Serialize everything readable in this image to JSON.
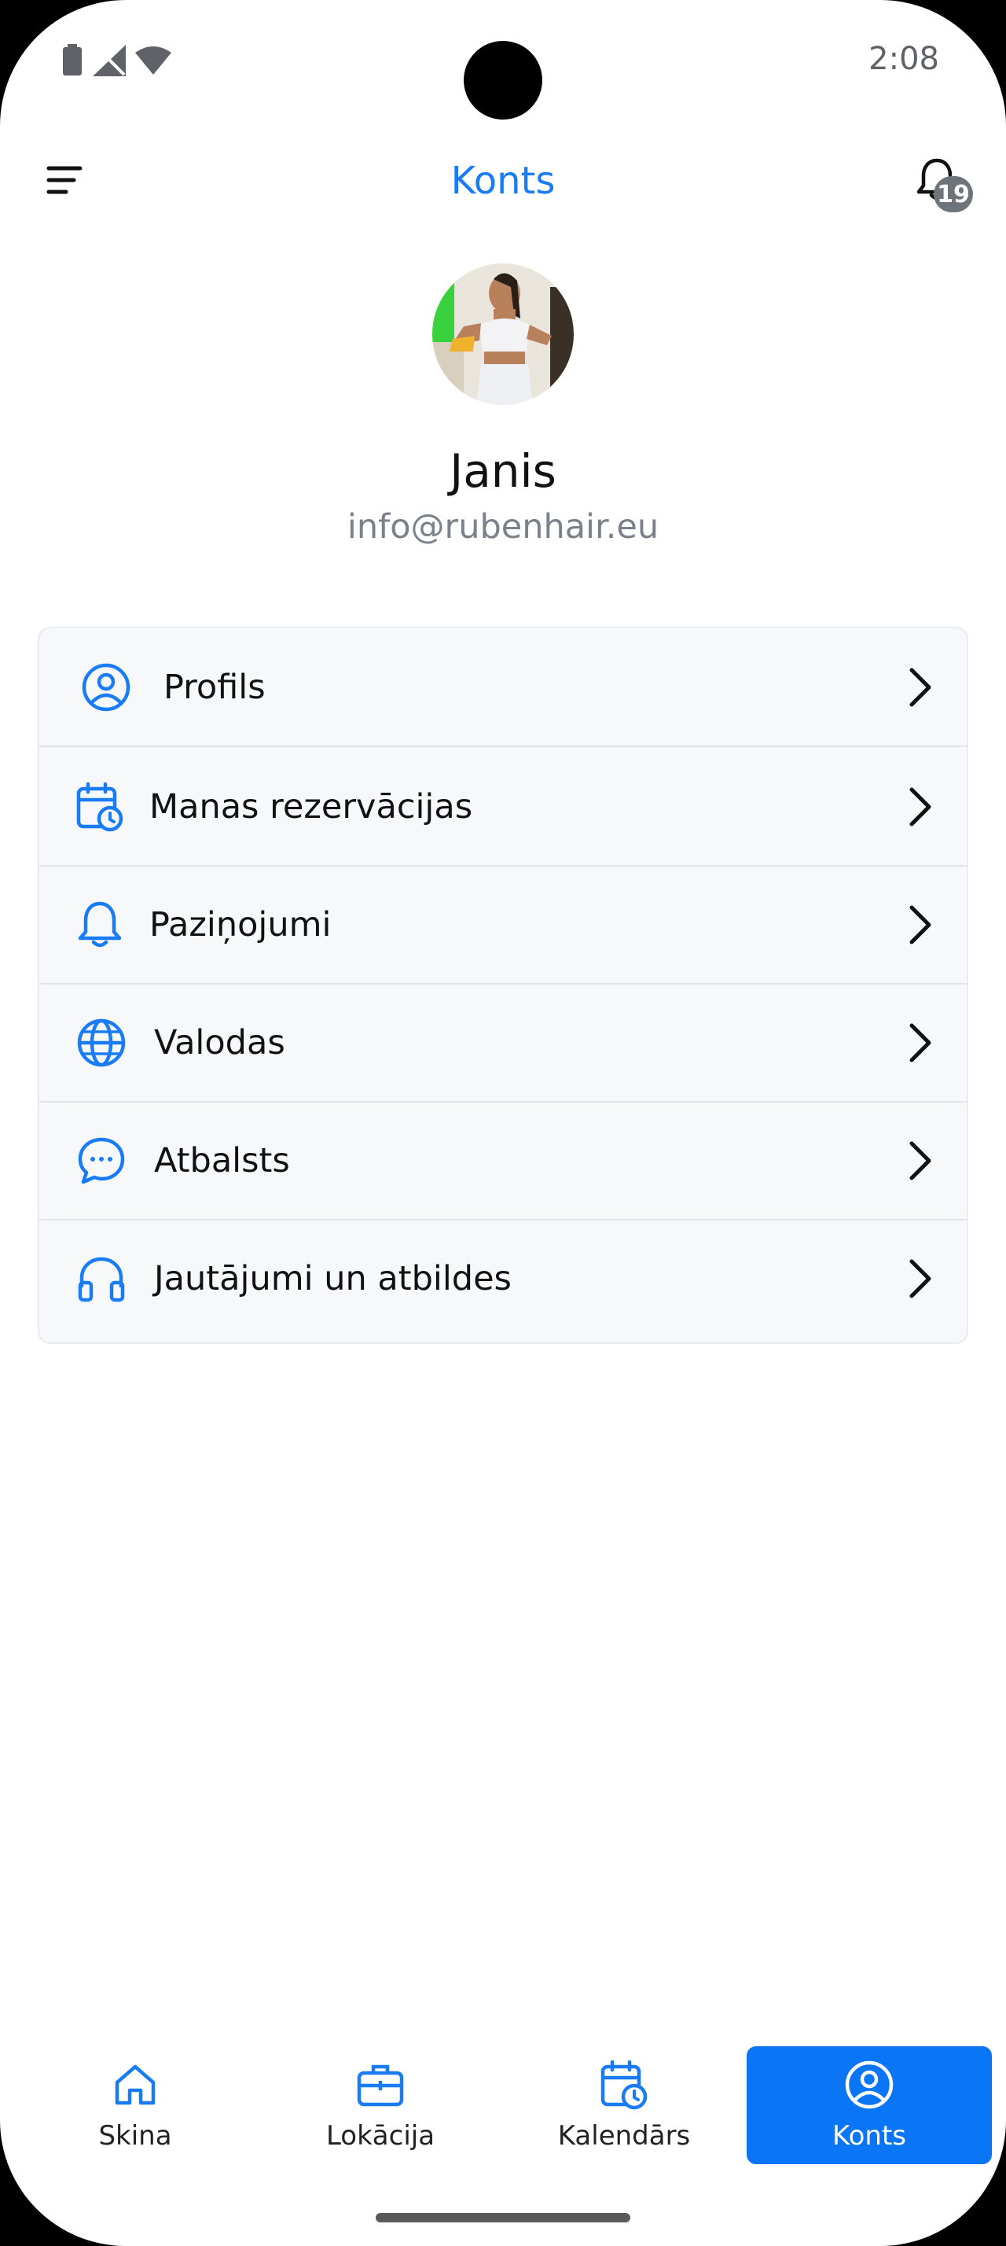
{
  "status_bar": {
    "time": "2:08",
    "icons": [
      "battery-icon",
      "signal-icon",
      "wifi-icon"
    ]
  },
  "header": {
    "title": "Konts",
    "menu_icon": "menu-icon",
    "notification_icon": "bell-icon",
    "notification_count": "19"
  },
  "profile": {
    "name": "Janis",
    "email": "info@rubenhair.eu"
  },
  "menu": {
    "items": [
      {
        "label": "Profils",
        "icon": "user-circle-icon"
      },
      {
        "label": "Manas rezervācijas",
        "icon": "calendar-clock-icon"
      },
      {
        "label": "Paziņojumi",
        "icon": "bell-icon"
      },
      {
        "label": "Valodas",
        "icon": "globe-icon"
      },
      {
        "label": "Atbalsts",
        "icon": "chat-bubble-icon"
      },
      {
        "label": "Jautājumi un atbildes",
        "icon": "headphones-icon"
      }
    ]
  },
  "bottom_nav": {
    "items": [
      {
        "label": "Skina",
        "icon": "home-icon",
        "active": false
      },
      {
        "label": "Lokācija",
        "icon": "briefcase-icon",
        "active": false
      },
      {
        "label": "Kalendārs",
        "icon": "calendar-clock-icon",
        "active": false
      },
      {
        "label": "Konts",
        "icon": "user-circle-icon",
        "active": true
      }
    ]
  },
  "colors": {
    "accent": "#1a7cf5",
    "active_tab": "#0a76f5",
    "card_background": "#f6f8fa",
    "badge": "#6f747b"
  }
}
